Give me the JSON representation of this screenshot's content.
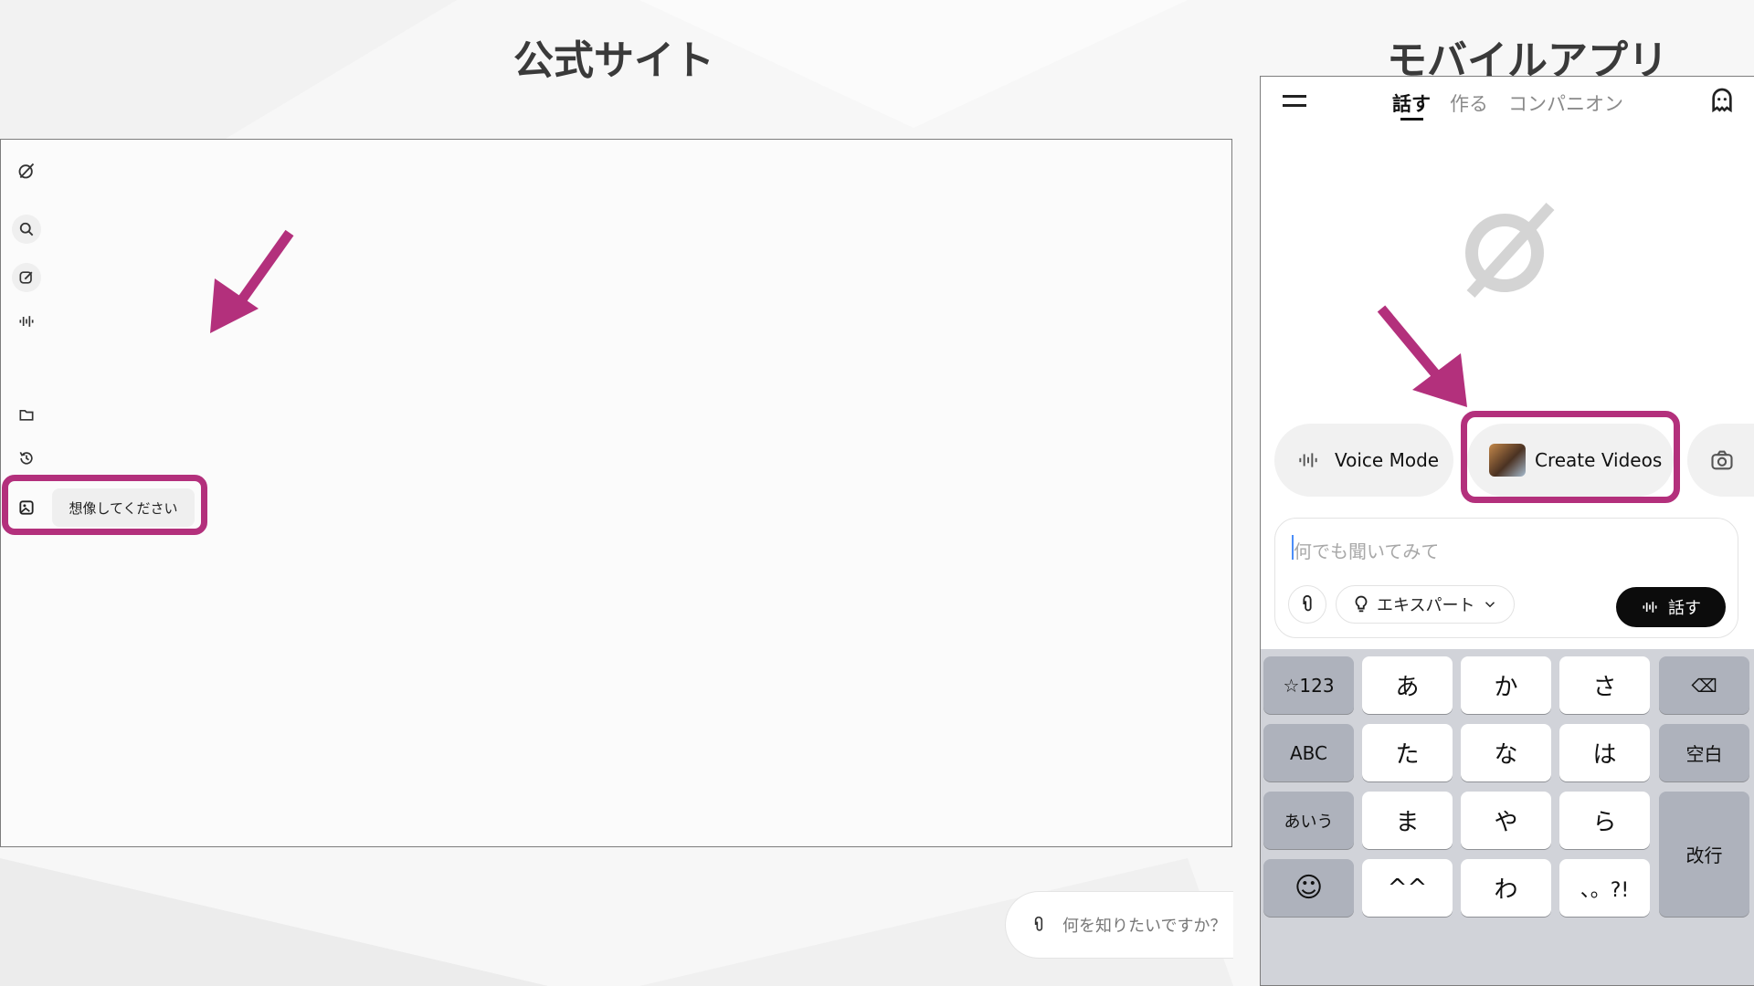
{
  "titles": {
    "web": "公式サイト",
    "mobile": "モバイルアプリ"
  },
  "colors": {
    "highlight": "#b3307c",
    "arrow": "#b3307c",
    "background": "#f7f7f7"
  },
  "web": {
    "sidebar_icons": [
      "grok-logo-icon",
      "search-icon",
      "edit-icon",
      "voice-wave-icon",
      "imagine-icon",
      "folder-icon",
      "history-icon"
    ],
    "tooltip": "想像してください",
    "input_placeholder": "何を知りたいですか？"
  },
  "mobile": {
    "tabs": [
      {
        "label": "話す",
        "active": true
      },
      {
        "label": "作る",
        "active": false
      },
      {
        "label": "コンパニオン",
        "active": false
      }
    ],
    "quick_actions": [
      {
        "label": "Voice Mode",
        "icon": "voice-wave-icon"
      },
      {
        "label": "Create Videos",
        "icon": "video-thumbnail-icon"
      },
      {
        "label": "",
        "icon": "camera-icon"
      }
    ],
    "input_placeholder": "何でも聞いてみて",
    "mode_chip": "エキスパート",
    "speak_button": "話す",
    "keyboard": {
      "row1": [
        "☆123",
        "あ",
        "か",
        "さ",
        "⌫"
      ],
      "row2": [
        "ABC",
        "た",
        "な",
        "は",
        "空白"
      ],
      "row3": [
        "あいう",
        "ま",
        "や",
        "ら"
      ],
      "row4": [
        "☺",
        "^^",
        "わ",
        "、。?!"
      ],
      "enter": "改行"
    }
  }
}
